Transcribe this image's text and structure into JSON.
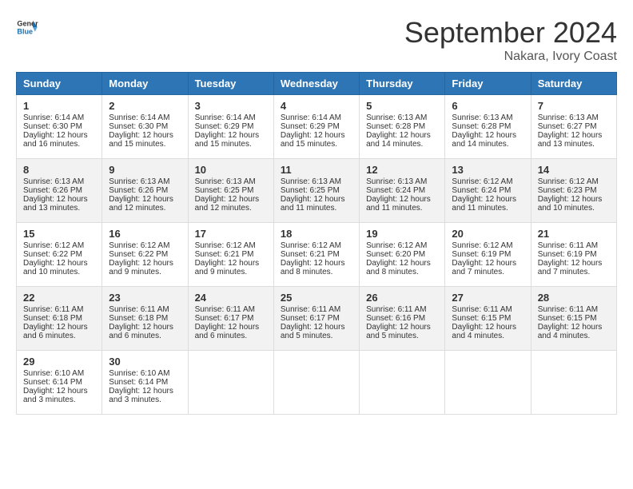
{
  "logo": {
    "line1": "General",
    "line2": "Blue"
  },
  "title": "September 2024",
  "subtitle": "Nakara, Ivory Coast",
  "headers": [
    "Sunday",
    "Monday",
    "Tuesday",
    "Wednesday",
    "Thursday",
    "Friday",
    "Saturday"
  ],
  "weeks": [
    [
      {
        "day": "1",
        "sunrise": "6:14 AM",
        "sunset": "6:30 PM",
        "daylight": "12 hours and 16 minutes."
      },
      {
        "day": "2",
        "sunrise": "6:14 AM",
        "sunset": "6:30 PM",
        "daylight": "12 hours and 15 minutes."
      },
      {
        "day": "3",
        "sunrise": "6:14 AM",
        "sunset": "6:29 PM",
        "daylight": "12 hours and 15 minutes."
      },
      {
        "day": "4",
        "sunrise": "6:14 AM",
        "sunset": "6:29 PM",
        "daylight": "12 hours and 15 minutes."
      },
      {
        "day": "5",
        "sunrise": "6:13 AM",
        "sunset": "6:28 PM",
        "daylight": "12 hours and 14 minutes."
      },
      {
        "day": "6",
        "sunrise": "6:13 AM",
        "sunset": "6:28 PM",
        "daylight": "12 hours and 14 minutes."
      },
      {
        "day": "7",
        "sunrise": "6:13 AM",
        "sunset": "6:27 PM",
        "daylight": "12 hours and 13 minutes."
      }
    ],
    [
      {
        "day": "8",
        "sunrise": "6:13 AM",
        "sunset": "6:26 PM",
        "daylight": "12 hours and 13 minutes."
      },
      {
        "day": "9",
        "sunrise": "6:13 AM",
        "sunset": "6:26 PM",
        "daylight": "12 hours and 12 minutes."
      },
      {
        "day": "10",
        "sunrise": "6:13 AM",
        "sunset": "6:25 PM",
        "daylight": "12 hours and 12 minutes."
      },
      {
        "day": "11",
        "sunrise": "6:13 AM",
        "sunset": "6:25 PM",
        "daylight": "12 hours and 11 minutes."
      },
      {
        "day": "12",
        "sunrise": "6:13 AM",
        "sunset": "6:24 PM",
        "daylight": "12 hours and 11 minutes."
      },
      {
        "day": "13",
        "sunrise": "6:12 AM",
        "sunset": "6:24 PM",
        "daylight": "12 hours and 11 minutes."
      },
      {
        "day": "14",
        "sunrise": "6:12 AM",
        "sunset": "6:23 PM",
        "daylight": "12 hours and 10 minutes."
      }
    ],
    [
      {
        "day": "15",
        "sunrise": "6:12 AM",
        "sunset": "6:22 PM",
        "daylight": "12 hours and 10 minutes."
      },
      {
        "day": "16",
        "sunrise": "6:12 AM",
        "sunset": "6:22 PM",
        "daylight": "12 hours and 9 minutes."
      },
      {
        "day": "17",
        "sunrise": "6:12 AM",
        "sunset": "6:21 PM",
        "daylight": "12 hours and 9 minutes."
      },
      {
        "day": "18",
        "sunrise": "6:12 AM",
        "sunset": "6:21 PM",
        "daylight": "12 hours and 8 minutes."
      },
      {
        "day": "19",
        "sunrise": "6:12 AM",
        "sunset": "6:20 PM",
        "daylight": "12 hours and 8 minutes."
      },
      {
        "day": "20",
        "sunrise": "6:12 AM",
        "sunset": "6:19 PM",
        "daylight": "12 hours and 7 minutes."
      },
      {
        "day": "21",
        "sunrise": "6:11 AM",
        "sunset": "6:19 PM",
        "daylight": "12 hours and 7 minutes."
      }
    ],
    [
      {
        "day": "22",
        "sunrise": "6:11 AM",
        "sunset": "6:18 PM",
        "daylight": "12 hours and 6 minutes."
      },
      {
        "day": "23",
        "sunrise": "6:11 AM",
        "sunset": "6:18 PM",
        "daylight": "12 hours and 6 minutes."
      },
      {
        "day": "24",
        "sunrise": "6:11 AM",
        "sunset": "6:17 PM",
        "daylight": "12 hours and 6 minutes."
      },
      {
        "day": "25",
        "sunrise": "6:11 AM",
        "sunset": "6:17 PM",
        "daylight": "12 hours and 5 minutes."
      },
      {
        "day": "26",
        "sunrise": "6:11 AM",
        "sunset": "6:16 PM",
        "daylight": "12 hours and 5 minutes."
      },
      {
        "day": "27",
        "sunrise": "6:11 AM",
        "sunset": "6:15 PM",
        "daylight": "12 hours and 4 minutes."
      },
      {
        "day": "28",
        "sunrise": "6:11 AM",
        "sunset": "6:15 PM",
        "daylight": "12 hours and 4 minutes."
      }
    ],
    [
      {
        "day": "29",
        "sunrise": "6:10 AM",
        "sunset": "6:14 PM",
        "daylight": "12 hours and 3 minutes."
      },
      {
        "day": "30",
        "sunrise": "6:10 AM",
        "sunset": "6:14 PM",
        "daylight": "12 hours and 3 minutes."
      },
      null,
      null,
      null,
      null,
      null
    ]
  ],
  "cell_labels": {
    "sunrise": "Sunrise: ",
    "sunset": "Sunset: ",
    "daylight": "Daylight: "
  }
}
